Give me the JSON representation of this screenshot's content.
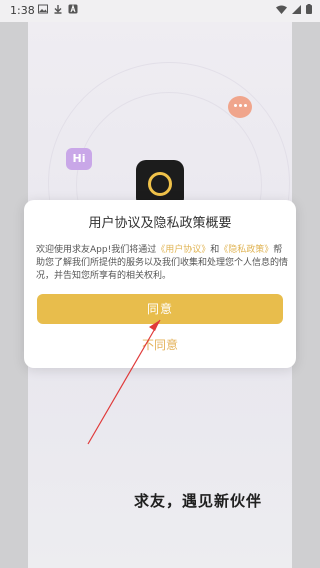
{
  "status_bar": {
    "time": "1:38",
    "left_icons": [
      "image-icon",
      "download-icon",
      "a-icon"
    ],
    "right_icons": [
      "wifi-icon",
      "signal-icon",
      "battery-icon"
    ]
  },
  "background": {
    "slogan": "求友，遇见新伙伴",
    "hi_badge": "Hi"
  },
  "dialog": {
    "title": "用户协议及隐私政策概要",
    "text_prefix": "欢迎使用求友App!我们将通过",
    "link1": "《用户协议》",
    "and": "和",
    "link2": "《隐私政策》",
    "text_suffix": "帮助您了解我们所提供的服务以及我们收集和处理您个人信息的情况，并告知您所享有的相关权利。",
    "agree_label": "同意",
    "disagree_label": "不同意"
  },
  "colors": {
    "accent": "#e8bd4c",
    "link": "#e0b454",
    "annotation_arrow": "#e03a3a"
  }
}
